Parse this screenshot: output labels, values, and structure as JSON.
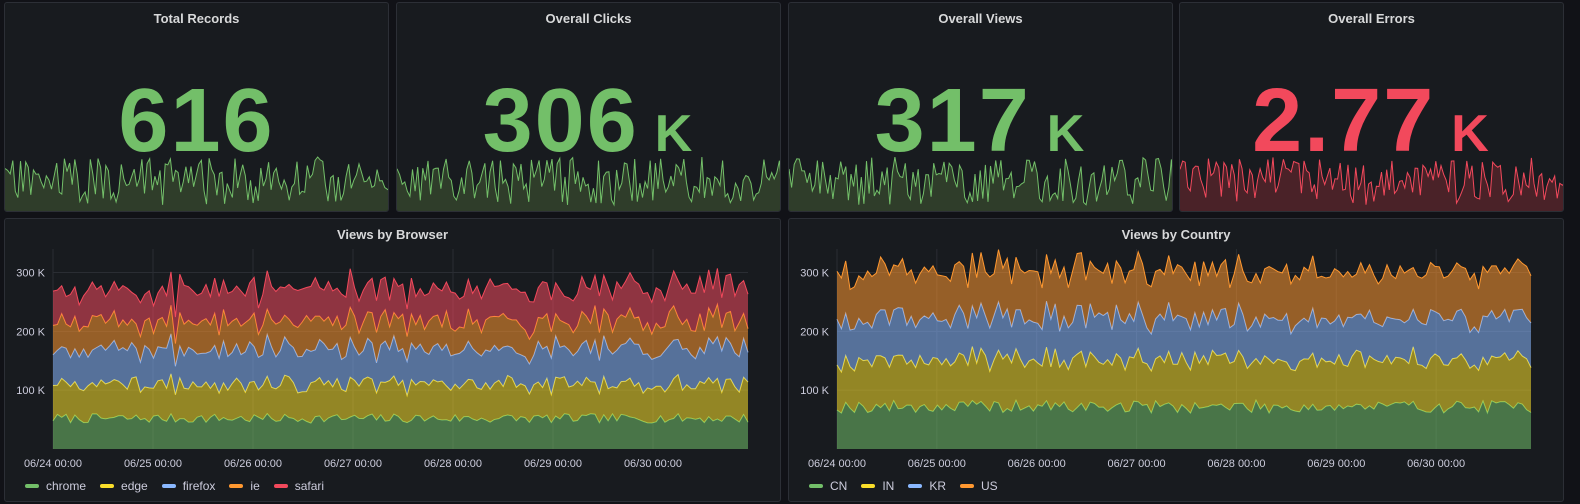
{
  "stats": [
    {
      "title": "Total Records",
      "value": "616",
      "unit": "",
      "color": "#73bf69",
      "fill": "#2f3d2a",
      "seed": 11
    },
    {
      "title": "Overall Clicks",
      "value": "306",
      "unit": "K",
      "color": "#73bf69",
      "fill": "#2f3d2a",
      "seed": 23
    },
    {
      "title": "Overall Views",
      "value": "317",
      "unit": "K",
      "color": "#73bf69",
      "fill": "#2f3d2a",
      "seed": 37
    },
    {
      "title": "Overall Errors",
      "value": "2.77",
      "unit": "K",
      "color": "#f2495c",
      "fill": "#4a2228",
      "seed": 53
    }
  ],
  "charts": {
    "browser": {
      "title": "Views by Browser",
      "type": "area",
      "stacked": true,
      "x_ticks": [
        "06/24 00:00",
        "06/25 00:00",
        "06/26 00:00",
        "06/27 00:00",
        "06/28 00:00",
        "06/29 00:00",
        "06/30 00:00"
      ],
      "y_ticks": [
        "100 K",
        "200 K",
        "300 K"
      ],
      "y_tick_values": [
        100000,
        200000,
        300000
      ],
      "ylim": [
        0,
        340000
      ],
      "series": [
        {
          "name": "chrome",
          "color": "#73bf69",
          "base": 52000,
          "amp": 8000
        },
        {
          "name": "edge",
          "color": "#fade2a",
          "base": 58000,
          "amp": 12000
        },
        {
          "name": "firefox",
          "color": "#8ab8ff",
          "base": 60000,
          "amp": 12000
        },
        {
          "name": "ie",
          "color": "#ff9830",
          "base": 48000,
          "amp": 11000
        },
        {
          "name": "safari",
          "color": "#f2495c",
          "base": 55000,
          "amp": 11000
        }
      ]
    },
    "country": {
      "title": "Views by Country",
      "type": "area",
      "stacked": true,
      "x_ticks": [
        "06/24 00:00",
        "06/25 00:00",
        "06/26 00:00",
        "06/27 00:00",
        "06/28 00:00",
        "06/29 00:00",
        "06/30 00:00"
      ],
      "y_ticks": [
        "100 K",
        "200 K",
        "300 K"
      ],
      "y_tick_values": [
        100000,
        200000,
        300000
      ],
      "ylim": [
        0,
        340000
      ],
      "series": [
        {
          "name": "CN",
          "color": "#73bf69",
          "base": 72000,
          "amp": 11000
        },
        {
          "name": "IN",
          "color": "#fade2a",
          "base": 80000,
          "amp": 13000
        },
        {
          "name": "KR",
          "color": "#8ab8ff",
          "base": 72000,
          "amp": 12000
        },
        {
          "name": "US",
          "color": "#ff9830",
          "base": 80000,
          "amp": 12000
        }
      ]
    }
  }
}
